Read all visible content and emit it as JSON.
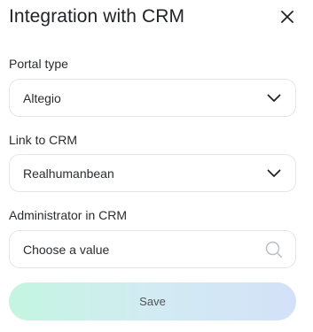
{
  "dialog": {
    "title": "Integration with CRM",
    "close_icon": "close-icon"
  },
  "fields": {
    "portal_type": {
      "label": "Portal type",
      "value": "Altegio",
      "icon": "chevron-down-icon"
    },
    "link_to_crm": {
      "label": "Link to CRM",
      "value": "Realhumanbean",
      "icon": "chevron-down-icon"
    },
    "administrator": {
      "label": "Administrator in CRM",
      "placeholder": "Choose a value",
      "icon": "search-icon"
    }
  },
  "actions": {
    "save_label": "Save"
  },
  "colors": {
    "text": "#222326",
    "border": "#e3e5ea",
    "save_gradient_start": "#c4f5e1",
    "save_gradient_end": "#d3e1f8"
  }
}
